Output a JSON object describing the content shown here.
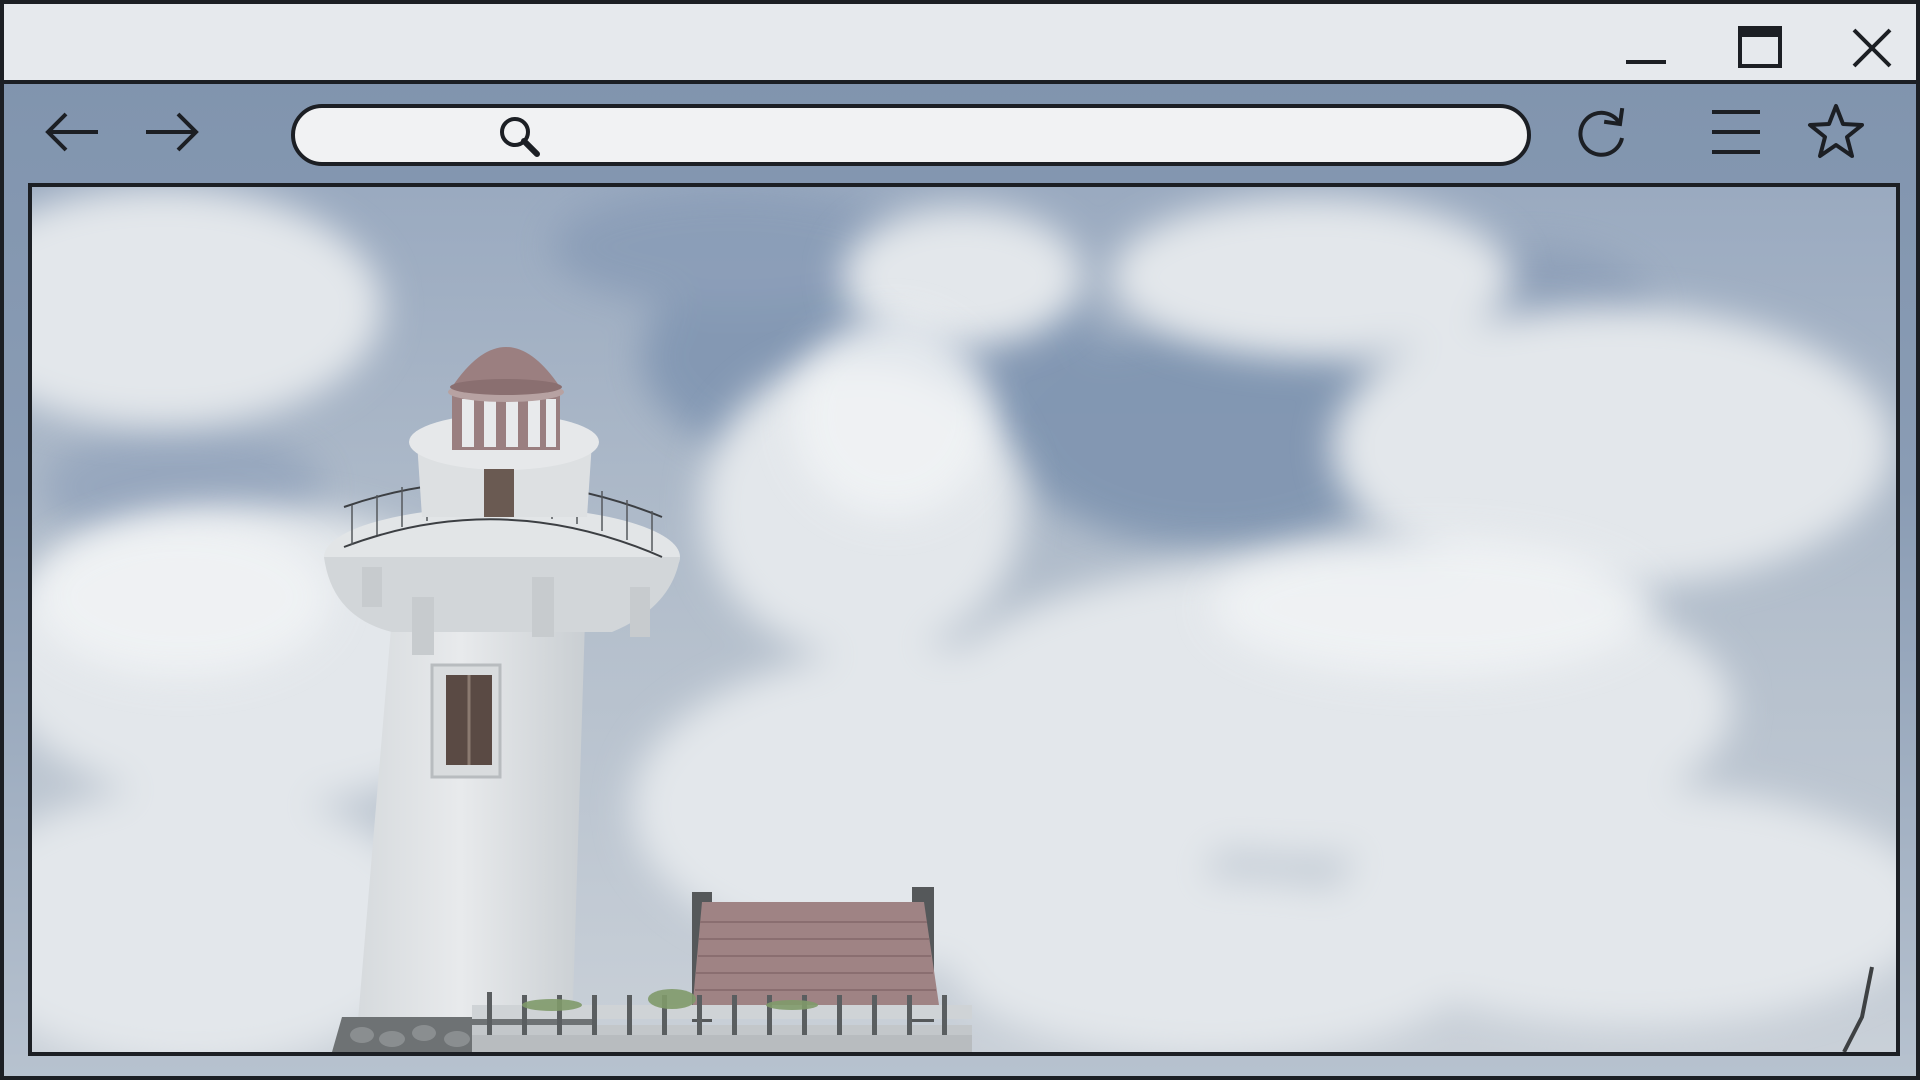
{
  "window": {
    "controls": {
      "minimize_icon": "minimize-icon",
      "maximize_icon": "maximize-icon",
      "close_icon": "close-icon"
    }
  },
  "toolbar": {
    "back_icon": "arrow-left-icon",
    "forward_icon": "arrow-right-icon",
    "reload_icon": "reload-icon",
    "menu_icon": "hamburger-menu-icon",
    "bookmark_icon": "star-icon"
  },
  "addressbar": {
    "search_icon": "search-icon",
    "value": "",
    "placeholder": ""
  },
  "content": {
    "image_subject": "lighthouse-photo"
  },
  "colors": {
    "frame": "#1c1f24",
    "titlebar": "#e6e9ed",
    "toolbar": "#8397b0",
    "addressbar": "#f1f2f3",
    "sky": "#9fb0c6",
    "cloud": "#dde2e7",
    "tower": "#e3e6e8",
    "roof": "#9b7f80"
  }
}
